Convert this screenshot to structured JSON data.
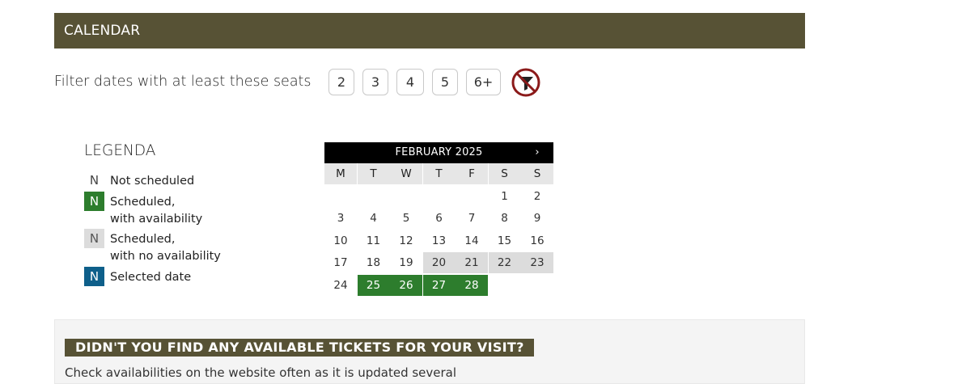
{
  "header": {
    "title": "CALENDAR"
  },
  "filter": {
    "label": "Filter dates with at least these seats",
    "options": [
      "2",
      "3",
      "4",
      "5",
      "6+"
    ],
    "clear_icon": "filter-off-icon",
    "clear_icon_color": "#8b1a1a"
  },
  "legend": {
    "title": "LEGENDA",
    "items": [
      {
        "symbol": "N",
        "label": "Not scheduled",
        "color": "#ffffff"
      },
      {
        "symbol": "N",
        "label": "Scheduled,\nwith availability",
        "color": "#2d7d2d"
      },
      {
        "symbol": "N",
        "label": "Scheduled,\nwith no availability",
        "color": "#dcdcdc"
      },
      {
        "symbol": "N",
        "label": "Selected date",
        "color": "#0e5f8a"
      }
    ]
  },
  "calendar": {
    "month_title": "FEBRUARY 2025",
    "next_label": "›",
    "weekdays": [
      "M",
      "T",
      "W",
      "T",
      "F",
      "S",
      "S"
    ],
    "days": [
      {
        "d": "",
        "s": "empty"
      },
      {
        "d": "",
        "s": "empty"
      },
      {
        "d": "",
        "s": "empty"
      },
      {
        "d": "",
        "s": "empty"
      },
      {
        "d": "",
        "s": "empty"
      },
      {
        "d": "1",
        "s": "none"
      },
      {
        "d": "2",
        "s": "none"
      },
      {
        "d": "3",
        "s": "none"
      },
      {
        "d": "4",
        "s": "none"
      },
      {
        "d": "5",
        "s": "none"
      },
      {
        "d": "6",
        "s": "none"
      },
      {
        "d": "7",
        "s": "none"
      },
      {
        "d": "8",
        "s": "none"
      },
      {
        "d": "9",
        "s": "none"
      },
      {
        "d": "10",
        "s": "none"
      },
      {
        "d": "11",
        "s": "none"
      },
      {
        "d": "12",
        "s": "none"
      },
      {
        "d": "13",
        "s": "none"
      },
      {
        "d": "14",
        "s": "none"
      },
      {
        "d": "15",
        "s": "none"
      },
      {
        "d": "16",
        "s": "none"
      },
      {
        "d": "17",
        "s": "none"
      },
      {
        "d": "18",
        "s": "none"
      },
      {
        "d": "19",
        "s": "none"
      },
      {
        "d": "20",
        "s": "noavail"
      },
      {
        "d": "21",
        "s": "noavail"
      },
      {
        "d": "22",
        "s": "noavail"
      },
      {
        "d": "23",
        "s": "noavail"
      },
      {
        "d": "24",
        "s": "none"
      },
      {
        "d": "25",
        "s": "avail"
      },
      {
        "d": "26",
        "s": "avail"
      },
      {
        "d": "27",
        "s": "avail"
      },
      {
        "d": "28",
        "s": "avail"
      },
      {
        "d": "",
        "s": "empty"
      },
      {
        "d": "",
        "s": "empty"
      }
    ]
  },
  "info": {
    "title": "DIDN'T YOU FIND ANY AVAILABLE TICKETS FOR YOUR VISIT?",
    "text": "Check availabilities on the website often as it is updated several"
  },
  "colors": {
    "accent": "#575235",
    "available": "#2d7d2d",
    "no_availability": "#dcdcdc",
    "selected": "#0e5f8a"
  }
}
